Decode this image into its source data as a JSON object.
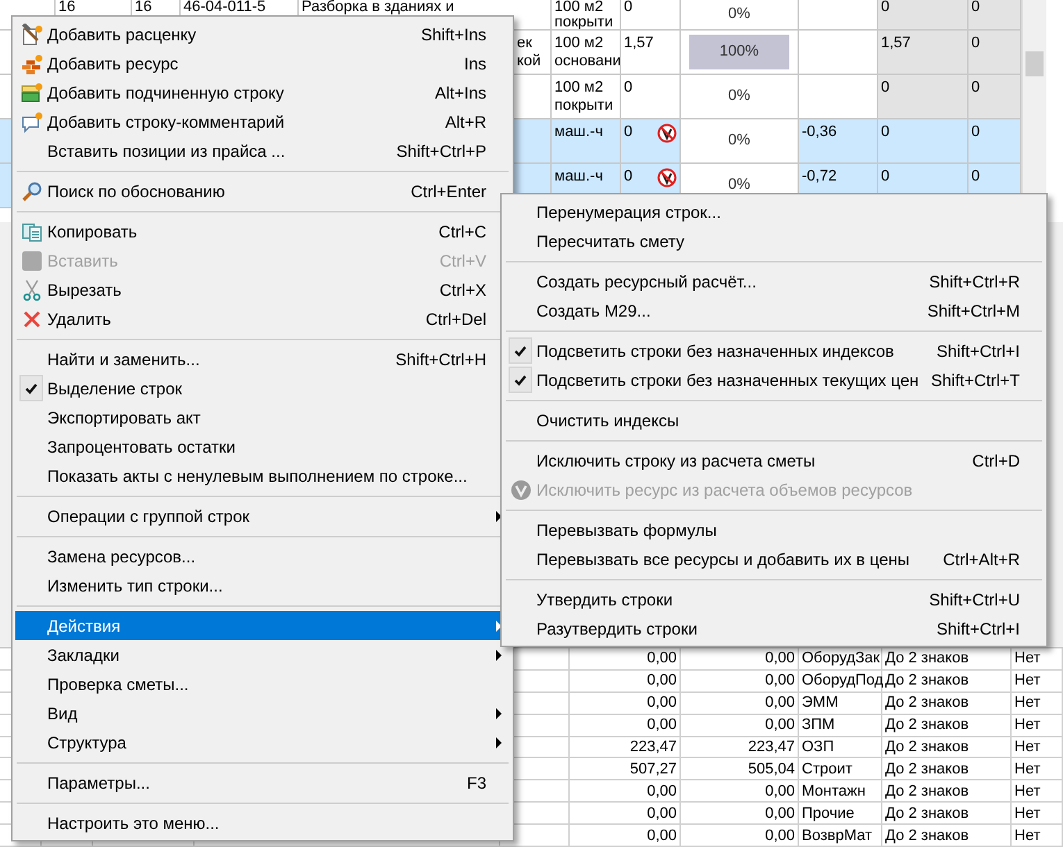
{
  "top_table": {
    "rows": [
      {
        "selected": false,
        "excluded": false,
        "column_1": "16",
        "column_2": "16",
        "column_3": "46-04-011-5",
        "column_4": "Разборка в зданиях и",
        "column_6": "100 м2 покрыти",
        "column_7": "0",
        "column_8": "0%",
        "column_10": "0",
        "column_11": "0"
      },
      {
        "selected": false,
        "excluded": false,
        "level": 1,
        "column_5": "ек кой",
        "column_6": "100 м2 основани",
        "column_7": "1,57",
        "column_8": "100%",
        "column_10": "1,57",
        "column_11": "0"
      },
      {
        "selected": false,
        "excluded": false,
        "column_6": "100 м2 покрыти",
        "column_7": "0",
        "column_8": "0%",
        "column_10": "0",
        "column_11": "0"
      },
      {
        "selected": true,
        "excluded": true,
        "column_6": "маш.-ч",
        "column_7": "0",
        "column_8": "0%",
        "column_9": "-0,36",
        "column_10": "0",
        "column_11": "0"
      },
      {
        "selected": true,
        "excluded": true,
        "column_6": "маш.-ч",
        "column_7": "0",
        "column_8": "0%",
        "column_9": "-0,72",
        "column_10": "0",
        "column_11": "0"
      }
    ]
  },
  "bottom_table": {
    "rows": [
      {
        "column_5": "0,00",
        "column_6": "0,00",
        "column_7": "ОборудЗак",
        "column_8": "До 2 знаков",
        "column_9": "Нет"
      },
      {
        "column_5": "0,00",
        "column_6": "0,00",
        "column_7": "ОборудПод",
        "column_8": "До 2 знаков",
        "column_9": "Нет"
      },
      {
        "column_5": "0,00",
        "column_6": "0,00",
        "column_7": "ЭММ",
        "column_8": "До 2 знаков",
        "column_9": "Нет"
      },
      {
        "column_5": "0,00",
        "column_6": "0,00",
        "column_7": "ЗПМ",
        "column_8": "До 2 знаков",
        "column_9": "Нет"
      },
      {
        "column_5": "223,47",
        "column_6": "223,47",
        "column_7": "ОЗП",
        "column_8": "До 2 знаков",
        "column_9": "Нет"
      },
      {
        "column_5": "507,27",
        "column_6": "505,04",
        "column_7": "Строит",
        "column_8": "До 2 знаков",
        "column_9": "Нет"
      },
      {
        "column_5": "0,00",
        "column_6": "0,00",
        "column_7": "Монтажн",
        "column_8": "До 2 знаков",
        "column_9": "Нет"
      },
      {
        "column_5": "0,00",
        "column_6": "0,00",
        "column_7": "Прочие",
        "column_8": "До 2 знаков",
        "column_9": "Нет"
      },
      {
        "column_5": "0,00",
        "column_6": "0,00",
        "column_7": "ВозврМат",
        "column_8": "До 2 знаков",
        "column_9": "Нет"
      }
    ]
  },
  "context_menu": {
    "items": [
      {
        "kind": "item",
        "label": "Добавить расценку",
        "shortcut": "Shift+Ins",
        "disabled": false,
        "selected": false
      },
      {
        "kind": "item",
        "label": "Добавить ресурс",
        "shortcut": "Ins",
        "disabled": false,
        "selected": false
      },
      {
        "kind": "item",
        "label": "Добавить подчиненную строку",
        "shortcut": "Alt+Ins",
        "disabled": false,
        "selected": false
      },
      {
        "kind": "item",
        "label": "Добавить строку-комментарий",
        "shortcut": "Alt+R",
        "disabled": false,
        "selected": false
      },
      {
        "kind": "item",
        "label": "Вставить позиции из прайса ...",
        "shortcut": "Shift+Ctrl+P",
        "disabled": false,
        "selected": false
      },
      {
        "kind": "separator"
      },
      {
        "kind": "item",
        "label": "Поиск по обоснованию",
        "shortcut": "Ctrl+Enter",
        "disabled": false,
        "selected": false
      },
      {
        "kind": "separator"
      },
      {
        "kind": "item",
        "label": "Копировать",
        "shortcut": "Ctrl+C",
        "disabled": false,
        "selected": false
      },
      {
        "kind": "item",
        "label": "Вставить",
        "shortcut": "Ctrl+V",
        "disabled": true,
        "selected": false
      },
      {
        "kind": "item",
        "label": "Вырезать",
        "shortcut": "Ctrl+X",
        "disabled": false,
        "selected": false
      },
      {
        "kind": "item",
        "label": "Удалить",
        "shortcut": "Ctrl+Del",
        "disabled": false,
        "selected": false
      },
      {
        "kind": "separator"
      },
      {
        "kind": "item",
        "label": "Найти и заменить...",
        "shortcut": "Shift+Ctrl+H",
        "disabled": false,
        "selected": false
      },
      {
        "kind": "item",
        "label": "Выделение строк",
        "checked": true,
        "disabled": false,
        "selected": false
      },
      {
        "kind": "item",
        "label": "Экспортировать акт",
        "disabled": false,
        "selected": false
      },
      {
        "kind": "item",
        "label": "Запроцентовать остатки",
        "disabled": false,
        "selected": false
      },
      {
        "kind": "item",
        "label": "Показать акты с ненулевым выполнением по строке...",
        "disabled": false,
        "selected": false
      },
      {
        "kind": "separator"
      },
      {
        "kind": "item",
        "label": "Операции с группой строк",
        "disabled": false,
        "selected": false,
        "submenu": true
      },
      {
        "kind": "separator"
      },
      {
        "kind": "item",
        "label": "Замена ресурсов...",
        "disabled": false,
        "selected": false
      },
      {
        "kind": "item",
        "label": "Изменить тип строки...",
        "disabled": false,
        "selected": false
      },
      {
        "kind": "separator"
      },
      {
        "kind": "item",
        "label": "Действия",
        "disabled": false,
        "selected": true,
        "submenu": true,
        "children": [
          {
            "kind": "item",
            "label": "Перенумерация строк...",
            "disabled": false
          },
          {
            "kind": "item",
            "label": "Пересчитать смету",
            "disabled": false
          },
          {
            "kind": "separator"
          },
          {
            "kind": "item",
            "label": "Создать ресурсный расчёт...",
            "shortcut": "Shift+Ctrl+R",
            "disabled": false
          },
          {
            "kind": "item",
            "label": "Создать М29...",
            "shortcut": "Shift+Ctrl+M",
            "disabled": false
          },
          {
            "kind": "separator"
          },
          {
            "kind": "item",
            "label": "Подсветить строки без назначенных индексов",
            "shortcut": "Shift+Ctrl+I",
            "checked": true,
            "disabled": false
          },
          {
            "kind": "item",
            "label": "Подсветить строки без назначенных текущих цен",
            "shortcut": "Shift+Ctrl+T",
            "checked": true,
            "disabled": false
          },
          {
            "kind": "separator"
          },
          {
            "kind": "item",
            "label": "Очистить индексы",
            "disabled": false
          },
          {
            "kind": "separator"
          },
          {
            "kind": "item",
            "label": "Исключить строку из расчета сметы",
            "shortcut": "Ctrl+D",
            "disabled": false
          },
          {
            "kind": "item",
            "label": "Исключить ресурс из расчета объемов ресурсов",
            "disabled": true
          },
          {
            "kind": "separator"
          },
          {
            "kind": "item",
            "label": "Перевызвать формулы",
            "disabled": false
          },
          {
            "kind": "item",
            "label": "Перевызвать все ресурсы и добавить их в цены",
            "shortcut": "Ctrl+Alt+R",
            "disabled": false
          },
          {
            "kind": "separator"
          },
          {
            "kind": "item",
            "label": "Утвердить строки",
            "shortcut": "Shift+Ctrl+U",
            "disabled": false
          },
          {
            "kind": "item",
            "label": "Разутвердить строки",
            "shortcut": "Shift+Ctrl+I",
            "disabled": false
          }
        ]
      },
      {
        "kind": "item",
        "label": "Закладки",
        "disabled": false,
        "selected": false,
        "submenu": true
      },
      {
        "kind": "item",
        "label": "Проверка сметы...",
        "disabled": false,
        "selected": false
      },
      {
        "kind": "item",
        "label": "Вид",
        "disabled": false,
        "selected": false,
        "submenu": true
      },
      {
        "kind": "item",
        "label": "Структура",
        "disabled": false,
        "selected": false,
        "submenu": true
      },
      {
        "kind": "separator"
      },
      {
        "kind": "item",
        "label": "Параметры...",
        "shortcut": "F3",
        "disabled": false,
        "selected": false
      },
      {
        "kind": "separator"
      },
      {
        "kind": "item",
        "label": "Настроить это меню...",
        "disabled": false,
        "selected": false
      }
    ]
  }
}
